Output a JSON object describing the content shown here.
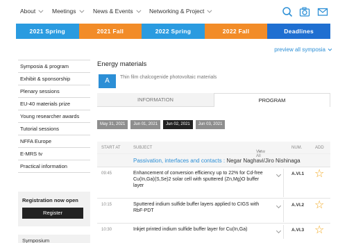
{
  "nav": {
    "items": [
      "About",
      "Meetings",
      "News & Events",
      "Networking & Project"
    ],
    "icons": [
      "search-icon",
      "camera-icon",
      "mail-icon"
    ],
    "icon_color": "#2c8fd6"
  },
  "year_tabs": [
    {
      "label": "2021 Spring",
      "color": "#2a9be0"
    },
    {
      "label": "2021 Fall",
      "color": "#f28c28"
    },
    {
      "label": "2022 Spring",
      "color": "#2a9be0"
    },
    {
      "label": "2022 Fall",
      "color": "#f28c28"
    },
    {
      "label": "Deadlines",
      "color": "#1f6fd1"
    }
  ],
  "preview_link": "preview all symposia",
  "sidebar": {
    "items": [
      "Symposia & program",
      "Exhibit & sponsorship",
      "Plenary sessions",
      "EU-40 materials prize",
      "Young researcher awards",
      "Tutorial sessions",
      "NFFA Europe",
      "E-MRS tv",
      "Practical information"
    ],
    "registration_title": "Registration now open",
    "register_button": "Register",
    "symposia_box": "Symposium"
  },
  "main": {
    "title": "Energy materials",
    "badge": "A",
    "subtitle": "Thin film chalcogenide photovoltaic materials",
    "tabs": {
      "information": "INFORMATION",
      "program": "PROGRAM"
    },
    "dates": [
      {
        "label": "May 31, 2021",
        "active": false
      },
      {
        "label": "Jun 01, 2021",
        "active": false
      },
      {
        "label": "Jun 02, 2021",
        "active": true
      },
      {
        "label": "Jun 03, 2021",
        "active": false
      }
    ],
    "table_headers": {
      "start": "START AT",
      "subject": "SUBJECT",
      "view": "View All",
      "num": "NUM.",
      "add": "ADD"
    },
    "session": {
      "title": "Passivation, interfaces and contacts :",
      "chairs": "Negar Naghavi/Jiro Nishinaga"
    },
    "rows": [
      {
        "time": "09:45",
        "subject": "Enhancement of conversion efficiency up to 22% for Cd-free Cu(In,Ga)(S,Se)2 solar cell with sputtered (Zn,Mg)O buffer layer",
        "num": "A.VI.1"
      },
      {
        "time": "10:15",
        "subject": "Sputtered indium sulfide buffer layers applied to CIGS with RbF-PDT",
        "num": "A.VI.2"
      },
      {
        "time": "10:30",
        "subject": "Inkjet printed indium sulfide buffer layer for Cu(In,Ga)",
        "num": "A.VI.3"
      }
    ]
  }
}
